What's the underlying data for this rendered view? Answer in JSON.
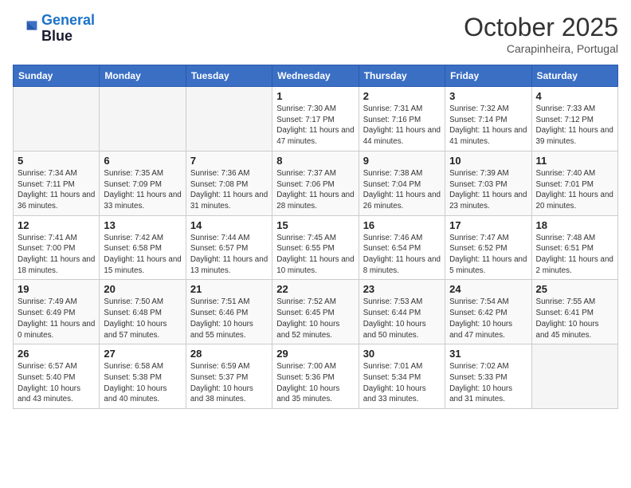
{
  "header": {
    "logo_line1": "General",
    "logo_line2": "Blue",
    "month": "October 2025",
    "location": "Carapinheira, Portugal"
  },
  "weekdays": [
    "Sunday",
    "Monday",
    "Tuesday",
    "Wednesday",
    "Thursday",
    "Friday",
    "Saturday"
  ],
  "weeks": [
    [
      {
        "day": "",
        "info": ""
      },
      {
        "day": "",
        "info": ""
      },
      {
        "day": "",
        "info": ""
      },
      {
        "day": "1",
        "info": "Sunrise: 7:30 AM\nSunset: 7:17 PM\nDaylight: 11 hours and 47 minutes."
      },
      {
        "day": "2",
        "info": "Sunrise: 7:31 AM\nSunset: 7:16 PM\nDaylight: 11 hours and 44 minutes."
      },
      {
        "day": "3",
        "info": "Sunrise: 7:32 AM\nSunset: 7:14 PM\nDaylight: 11 hours and 41 minutes."
      },
      {
        "day": "4",
        "info": "Sunrise: 7:33 AM\nSunset: 7:12 PM\nDaylight: 11 hours and 39 minutes."
      }
    ],
    [
      {
        "day": "5",
        "info": "Sunrise: 7:34 AM\nSunset: 7:11 PM\nDaylight: 11 hours and 36 minutes."
      },
      {
        "day": "6",
        "info": "Sunrise: 7:35 AM\nSunset: 7:09 PM\nDaylight: 11 hours and 33 minutes."
      },
      {
        "day": "7",
        "info": "Sunrise: 7:36 AM\nSunset: 7:08 PM\nDaylight: 11 hours and 31 minutes."
      },
      {
        "day": "8",
        "info": "Sunrise: 7:37 AM\nSunset: 7:06 PM\nDaylight: 11 hours and 28 minutes."
      },
      {
        "day": "9",
        "info": "Sunrise: 7:38 AM\nSunset: 7:04 PM\nDaylight: 11 hours and 26 minutes."
      },
      {
        "day": "10",
        "info": "Sunrise: 7:39 AM\nSunset: 7:03 PM\nDaylight: 11 hours and 23 minutes."
      },
      {
        "day": "11",
        "info": "Sunrise: 7:40 AM\nSunset: 7:01 PM\nDaylight: 11 hours and 20 minutes."
      }
    ],
    [
      {
        "day": "12",
        "info": "Sunrise: 7:41 AM\nSunset: 7:00 PM\nDaylight: 11 hours and 18 minutes."
      },
      {
        "day": "13",
        "info": "Sunrise: 7:42 AM\nSunset: 6:58 PM\nDaylight: 11 hours and 15 minutes."
      },
      {
        "day": "14",
        "info": "Sunrise: 7:44 AM\nSunset: 6:57 PM\nDaylight: 11 hours and 13 minutes."
      },
      {
        "day": "15",
        "info": "Sunrise: 7:45 AM\nSunset: 6:55 PM\nDaylight: 11 hours and 10 minutes."
      },
      {
        "day": "16",
        "info": "Sunrise: 7:46 AM\nSunset: 6:54 PM\nDaylight: 11 hours and 8 minutes."
      },
      {
        "day": "17",
        "info": "Sunrise: 7:47 AM\nSunset: 6:52 PM\nDaylight: 11 hours and 5 minutes."
      },
      {
        "day": "18",
        "info": "Sunrise: 7:48 AM\nSunset: 6:51 PM\nDaylight: 11 hours and 2 minutes."
      }
    ],
    [
      {
        "day": "19",
        "info": "Sunrise: 7:49 AM\nSunset: 6:49 PM\nDaylight: 11 hours and 0 minutes."
      },
      {
        "day": "20",
        "info": "Sunrise: 7:50 AM\nSunset: 6:48 PM\nDaylight: 10 hours and 57 minutes."
      },
      {
        "day": "21",
        "info": "Sunrise: 7:51 AM\nSunset: 6:46 PM\nDaylight: 10 hours and 55 minutes."
      },
      {
        "day": "22",
        "info": "Sunrise: 7:52 AM\nSunset: 6:45 PM\nDaylight: 10 hours and 52 minutes."
      },
      {
        "day": "23",
        "info": "Sunrise: 7:53 AM\nSunset: 6:44 PM\nDaylight: 10 hours and 50 minutes."
      },
      {
        "day": "24",
        "info": "Sunrise: 7:54 AM\nSunset: 6:42 PM\nDaylight: 10 hours and 47 minutes."
      },
      {
        "day": "25",
        "info": "Sunrise: 7:55 AM\nSunset: 6:41 PM\nDaylight: 10 hours and 45 minutes."
      }
    ],
    [
      {
        "day": "26",
        "info": "Sunrise: 6:57 AM\nSunset: 5:40 PM\nDaylight: 10 hours and 43 minutes."
      },
      {
        "day": "27",
        "info": "Sunrise: 6:58 AM\nSunset: 5:38 PM\nDaylight: 10 hours and 40 minutes."
      },
      {
        "day": "28",
        "info": "Sunrise: 6:59 AM\nSunset: 5:37 PM\nDaylight: 10 hours and 38 minutes."
      },
      {
        "day": "29",
        "info": "Sunrise: 7:00 AM\nSunset: 5:36 PM\nDaylight: 10 hours and 35 minutes."
      },
      {
        "day": "30",
        "info": "Sunrise: 7:01 AM\nSunset: 5:34 PM\nDaylight: 10 hours and 33 minutes."
      },
      {
        "day": "31",
        "info": "Sunrise: 7:02 AM\nSunset: 5:33 PM\nDaylight: 10 hours and 31 minutes."
      },
      {
        "day": "",
        "info": ""
      }
    ]
  ]
}
